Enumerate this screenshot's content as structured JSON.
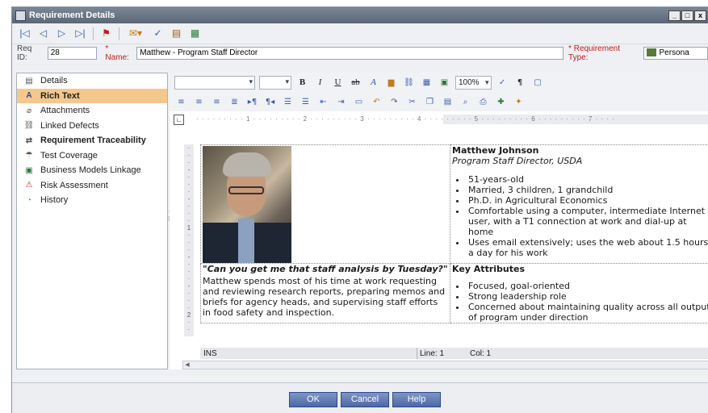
{
  "window": {
    "title": "Requirement Details"
  },
  "title_buttons": [
    "_",
    "□",
    "x"
  ],
  "toolbar1": {
    "icons": [
      "first-record-icon",
      "previous-record-icon",
      "next-record-icon",
      "last-record-icon",
      "flag-icon",
      "send-mail-icon",
      "spell-check-icon",
      "thesaurus-icon",
      "spelling-options-icon"
    ]
  },
  "req": {
    "id_label": "Req ID:",
    "id_value": "28",
    "name_label": "* Name:",
    "name_value": "Matthew - Program Staff Director",
    "type_label": "* Requirement Type:",
    "type_value": "Persona"
  },
  "sidebar": {
    "items": [
      {
        "label": "Details",
        "icon": "details-icon"
      },
      {
        "label": "Rich Text",
        "icon": "rich-text-icon"
      },
      {
        "label": "Attachments",
        "icon": "paperclip-icon"
      },
      {
        "label": "Linked Defects",
        "icon": "linked-defects-icon"
      },
      {
        "label": "Requirement Traceability",
        "icon": "traceability-icon"
      },
      {
        "label": "Test Coverage",
        "icon": "test-coverage-icon"
      },
      {
        "label": "Business Models Linkage",
        "icon": "business-models-icon"
      },
      {
        "label": "Risk Assessment",
        "icon": "risk-icon"
      },
      {
        "label": "History",
        "icon": "history-icon"
      }
    ]
  },
  "format": {
    "bold": "B",
    "italic": "I",
    "underline": "U",
    "strike": "ab",
    "fontcolor": "A",
    "zoom": "100%"
  },
  "ruler": {
    "numbers": [
      "1",
      "2",
      "3",
      "4",
      "5",
      "6",
      "7"
    ]
  },
  "doc": {
    "name": "Matthew Johnson",
    "title": "Program Staff Director, USDA",
    "bullets": [
      "51-years-old",
      "Married, 3 children, 1 grandchild",
      "Ph.D. in Agricultural Economics",
      "Comfortable using a computer, intermediate Internet user, with a T1 connection at work and dial-up at home",
      "Uses email extensively; uses the web about 1.5 hours a day for his work"
    ],
    "quote": "\"Can you get me that staff analysis by Tuesday?\"",
    "description": "Matthew spends most of his time at work requesting and reviewing research reports, preparing memos and briefs for agency heads, and supervising staff efforts in food safety and inspection.",
    "key_attributes_heading": "Key Attributes",
    "key_attributes": [
      "Focused, goal-oriented",
      "Strong leadership role",
      "Concerned about maintaining quality across all output of program under direction"
    ]
  },
  "status": {
    "mode": "INS",
    "line": "Line: 1",
    "col": "Col: 1"
  },
  "buttons": {
    "ok": "OK",
    "cancel": "Cancel",
    "help": "Help"
  }
}
